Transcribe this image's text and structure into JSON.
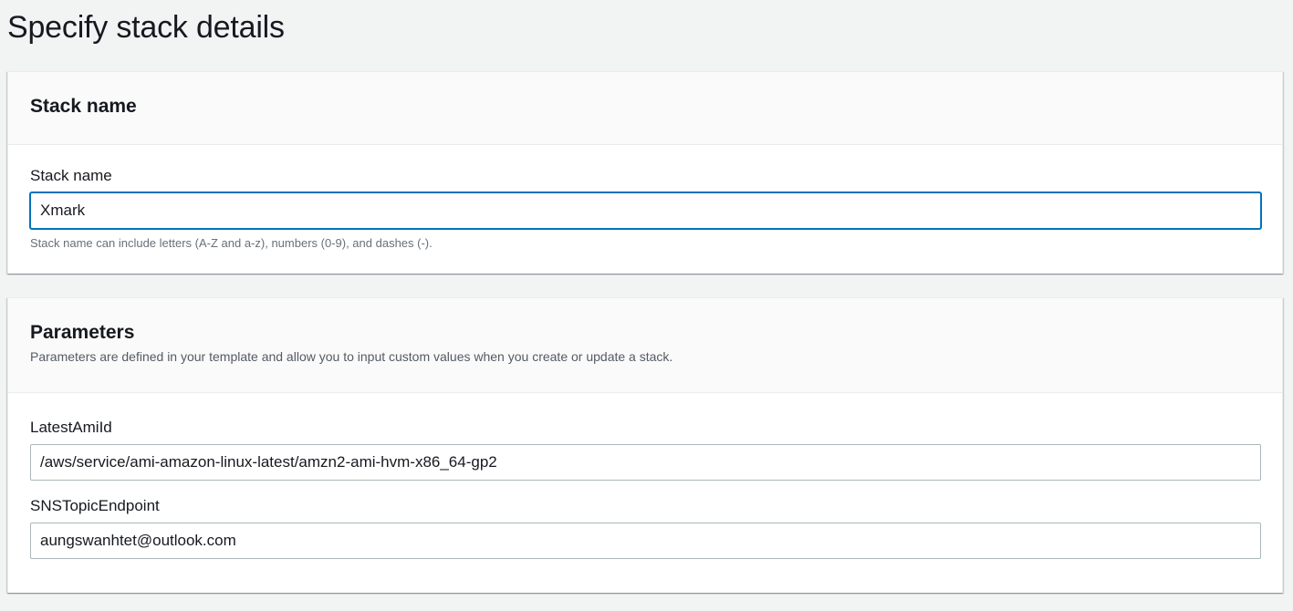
{
  "page": {
    "title": "Specify stack details"
  },
  "stack_name_panel": {
    "title": "Stack name",
    "field_label": "Stack name",
    "value": "Xmark",
    "constraint": "Stack name can include letters (A-Z and a-z), numbers (0-9), and dashes (-)."
  },
  "parameters_panel": {
    "title": "Parameters",
    "description": "Parameters are defined in your template and allow you to input custom values when you create or update a stack.",
    "fields": [
      {
        "label": "LatestAmiId",
        "value": "/aws/service/ami-amazon-linux-latest/amzn2-ami-hvm-x86_64-gp2"
      },
      {
        "label": "SNSTopicEndpoint",
        "value": "aungswanhtet@outlook.com"
      }
    ]
  },
  "colors": {
    "background": "#f2f3f3",
    "panel_header": "#fafafa",
    "focus_border": "#0073bb",
    "input_border": "#aab7b8",
    "muted_text": "#687078"
  }
}
